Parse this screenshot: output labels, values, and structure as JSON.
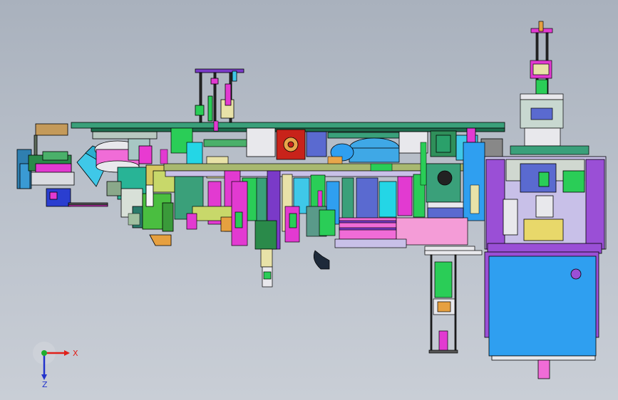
{
  "triad": {
    "x_label": "X",
    "y_label": "Y",
    "z_label": "Z",
    "x_color": "#e0201a",
    "y_color": "#1fae2e",
    "z_color": "#2233cc"
  },
  "colors": {
    "background_top": "#a9b1bd",
    "background_bottom": "#c9ced6",
    "frame_blue": "#2f9ff0",
    "frame_purple": "#9a4fd6",
    "plate_green": "#3aa07a",
    "accent_magenta": "#e83ad1",
    "accent_cyan": "#21d6e6"
  }
}
